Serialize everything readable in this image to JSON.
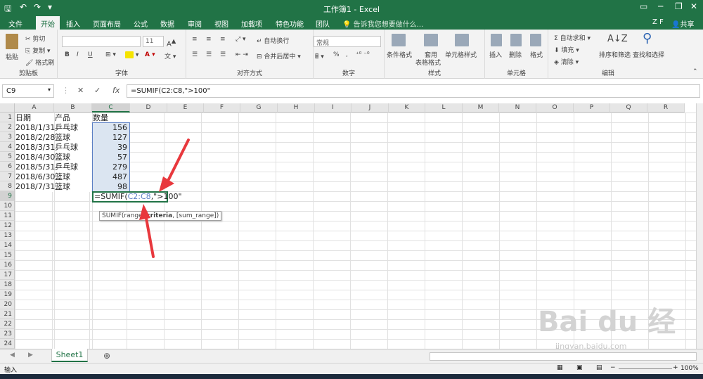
{
  "titlebar": {
    "title": "工作簿1 - Excel"
  },
  "tabs": [
    "文件",
    "开始",
    "插入",
    "页面布局",
    "公式",
    "数据",
    "审阅",
    "视图",
    "加载项",
    "特色功能",
    "团队"
  ],
  "tell_me": "告诉我您想要做什么...",
  "user": "Z F",
  "share": "共享",
  "ribbon": {
    "clipboard": {
      "paste": "粘贴",
      "cut": "剪切",
      "copy": "复制",
      "format_painter": "格式刷",
      "label": "剪贴板"
    },
    "font": {
      "size": "11",
      "bold": "B",
      "italic": "I",
      "underline": "U",
      "label": "字体"
    },
    "alignment": {
      "wrap": "自动换行",
      "merge": "合并后居中",
      "label": "对齐方式"
    },
    "number": {
      "format": "常规",
      "percent": "%",
      "comma": ",",
      "label": "数字"
    },
    "styles": {
      "conditional": "条件格式",
      "table1": "套用",
      "table2": "表格格式",
      "cell_styles": "单元格样式",
      "label": "样式"
    },
    "cells": {
      "insert": "插入",
      "delete": "删除",
      "format": "格式",
      "label": "单元格"
    },
    "editing": {
      "autosum": "自动求和",
      "fill": "填充",
      "clear": "清除",
      "sort": "排序和筛选",
      "find": "查找和选择",
      "label": "编辑"
    }
  },
  "formula_bar": {
    "name_box": "C9",
    "cancel": "✕",
    "enter": "✓",
    "fx": "fx",
    "formula": "=SUMIF(C2:C8,\">100\""
  },
  "columns": [
    "A",
    "B",
    "C",
    "D",
    "E",
    "F",
    "G",
    "H",
    "I",
    "J",
    "K",
    "L",
    "M",
    "N",
    "O",
    "P",
    "Q",
    "R"
  ],
  "rows": [
    "1",
    "2",
    "3",
    "4",
    "5",
    "6",
    "7",
    "8",
    "9",
    "10",
    "11",
    "12",
    "13",
    "14",
    "15",
    "16",
    "17",
    "18",
    "19",
    "20",
    "21",
    "22",
    "23",
    "24"
  ],
  "cells": {
    "header": {
      "a": "日期",
      "b": "产品",
      "c": "数量"
    },
    "data": [
      {
        "date": "2018/1/31",
        "product": "乒乓球",
        "qty": "156"
      },
      {
        "date": "2018/2/28",
        "product": "篮球",
        "qty": "127"
      },
      {
        "date": "2018/3/31",
        "product": "乒乓球",
        "qty": "39"
      },
      {
        "date": "2018/4/30",
        "product": "篮球",
        "qty": "57"
      },
      {
        "date": "2018/5/31",
        "product": "乒乓球",
        "qty": "279"
      },
      {
        "date": "2018/6/30",
        "product": "篮球",
        "qty": "487"
      },
      {
        "date": "2018/7/31",
        "product": "篮球",
        "qty": "98"
      }
    ]
  },
  "edit": {
    "pre": "=SUMIF(",
    "ref": "C2:C8",
    "post": ",\">100\""
  },
  "tooltip": {
    "pre": "SUMIF(range, ",
    "bold": "criteria",
    "post": ", [sum_range])"
  },
  "sheet_tab": "Sheet1",
  "status": {
    "mode": "输入",
    "zoom": "100%"
  },
  "watermark": "Bai du 经验",
  "watermark_sub": "jingyan.baidu.com",
  "colors": {
    "excel_green": "#217346",
    "arrow_red": "#e8383d",
    "ref_blue": "#5b7fc4"
  }
}
